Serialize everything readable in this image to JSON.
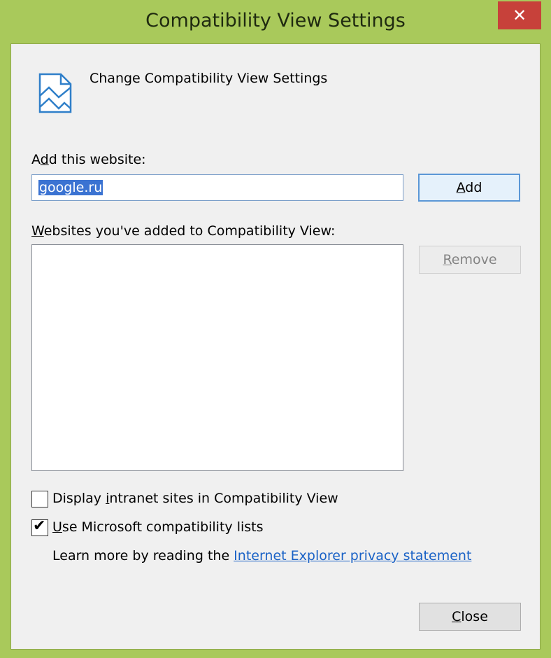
{
  "window": {
    "title": "Compatibility View Settings",
    "close_glyph": "✕"
  },
  "header": {
    "icon": "compatibility-view-icon",
    "text": "Change Compatibility View Settings"
  },
  "add_section": {
    "label_prefix": "A",
    "label_accel": "d",
    "label_suffix": "d this website:",
    "input_value": "google.ru",
    "add_button_accel": "A",
    "add_button_rest": "dd"
  },
  "list_section": {
    "label_accel": "W",
    "label_rest": "ebsites you've added to Compatibility View:",
    "items": [],
    "remove_button_accel": "R",
    "remove_button_rest": "emove"
  },
  "options": {
    "intranet": {
      "checked": false,
      "label_prefix": "Display ",
      "label_accel": "i",
      "label_suffix": "ntranet sites in Compatibility View"
    },
    "ms_lists": {
      "checked": true,
      "mark": "✔",
      "label_accel": "U",
      "label_rest": "se Microsoft compatibility lists"
    },
    "learn_more": "Learn more by reading the ",
    "privacy_link": "Internet Explorer privacy statement"
  },
  "footer": {
    "close_accel": "C",
    "close_rest": "lose"
  },
  "colors": {
    "frame": "#a9c95b",
    "close_button": "#c7413a",
    "selection": "#3b73d2",
    "link": "#1a62c6",
    "default_button_border": "#5b97d6"
  }
}
